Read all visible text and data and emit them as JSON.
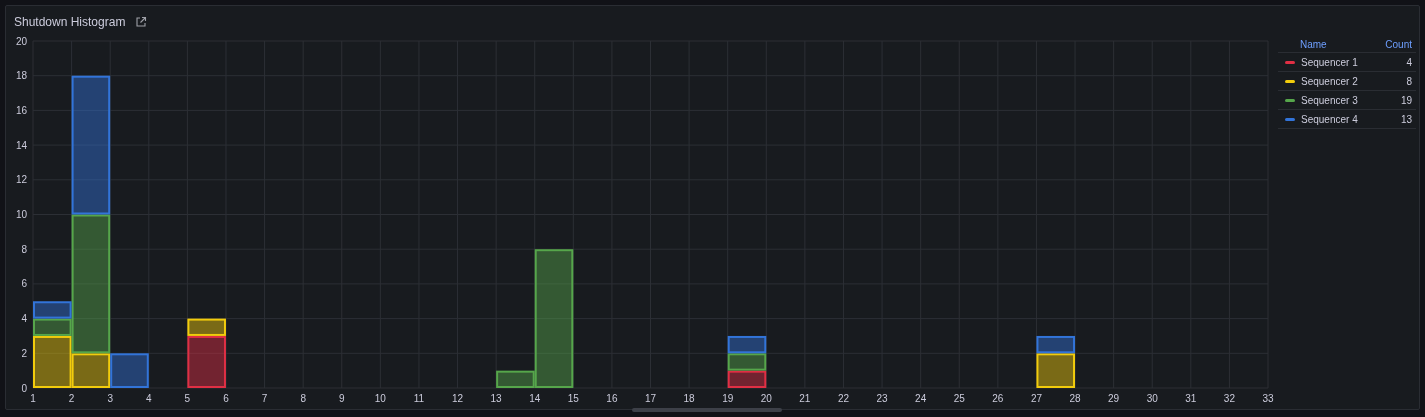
{
  "panel": {
    "title": "Shutdown Histogram"
  },
  "chart_data": {
    "type": "bar",
    "stacked": true,
    "orientation": "vertical",
    "grid": true,
    "xlim": [
      1,
      33
    ],
    "ylim": [
      0,
      20
    ],
    "x": [
      1.5,
      2.5,
      3.5,
      4.5,
      5.5,
      6.5,
      7.5,
      8.5,
      9.5,
      10.5,
      11.5,
      12.5,
      13.5,
      14.5,
      15.5,
      16.5,
      17.5,
      18.5,
      19.5,
      20.5,
      21.5,
      22.5,
      23.5,
      24.5,
      25.5,
      26.5,
      27.5,
      28.5,
      29.5,
      30.5,
      31.5,
      32.5
    ],
    "xticks": [
      1,
      2,
      3,
      4,
      5,
      6,
      7,
      8,
      9,
      10,
      11,
      12,
      13,
      14,
      15,
      16,
      17,
      18,
      19,
      20,
      21,
      22,
      23,
      24,
      25,
      26,
      27,
      28,
      29,
      30,
      31,
      32,
      33
    ],
    "yticks": [
      0,
      2,
      4,
      6,
      8,
      10,
      12,
      14,
      16,
      18,
      20
    ],
    "series": [
      {
        "name": "Sequencer 1",
        "color": "#e02f44",
        "values": [
          0,
          0,
          0,
          0,
          3,
          0,
          0,
          0,
          0,
          0,
          0,
          0,
          0,
          0,
          0,
          0,
          0,
          0,
          1,
          0,
          0,
          0,
          0,
          0,
          0,
          0,
          0,
          0,
          0,
          0,
          0,
          0
        ]
      },
      {
        "name": "Sequencer 2",
        "color": "#f2cc0c",
        "values": [
          3,
          2,
          0,
          0,
          1,
          0,
          0,
          0,
          0,
          0,
          0,
          0,
          0,
          0,
          0,
          0,
          0,
          0,
          0,
          0,
          0,
          0,
          0,
          0,
          0,
          0,
          2,
          0,
          0,
          0,
          0,
          0
        ]
      },
      {
        "name": "Sequencer 3",
        "color": "#56a64b",
        "values": [
          1,
          8,
          0,
          0,
          0,
          0,
          0,
          0,
          0,
          0,
          0,
          0,
          1,
          8,
          0,
          0,
          0,
          0,
          1,
          0,
          0,
          0,
          0,
          0,
          0,
          0,
          0,
          0,
          0,
          0,
          0,
          0
        ]
      },
      {
        "name": "Sequencer 4",
        "color": "#3274d9",
        "values": [
          1,
          8,
          2,
          0,
          0,
          0,
          0,
          0,
          0,
          0,
          0,
          0,
          0,
          0,
          0,
          0,
          0,
          0,
          1,
          0,
          0,
          0,
          0,
          0,
          0,
          0,
          1,
          0,
          0,
          0,
          0,
          0
        ]
      }
    ]
  },
  "legend": {
    "columns": [
      "Name",
      "Count"
    ],
    "counts": [
      "4",
      "8",
      "19",
      "13"
    ]
  }
}
